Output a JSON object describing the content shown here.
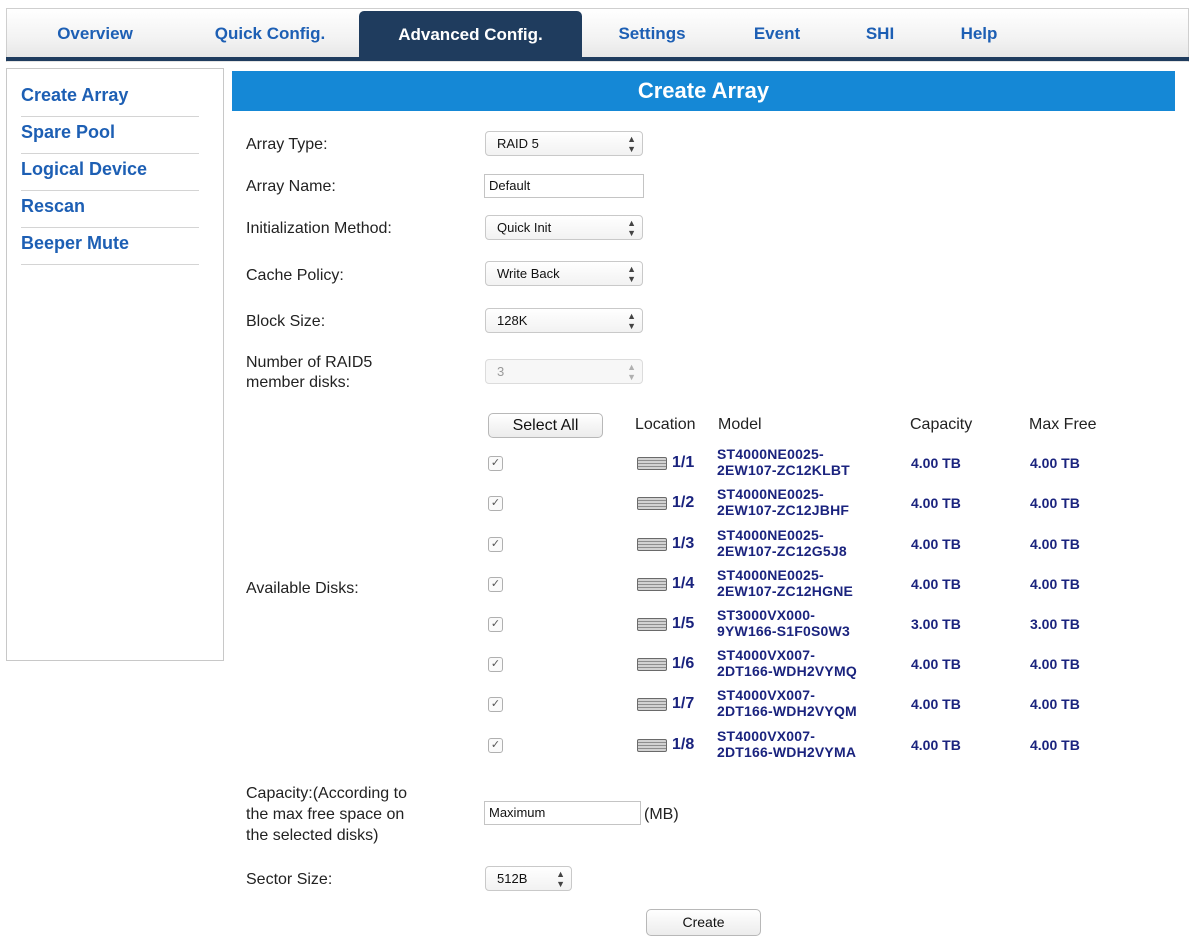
{
  "nav": {
    "tabs": [
      {
        "label": "Overview"
      },
      {
        "label": "Quick Config."
      },
      {
        "label": "Advanced Config.",
        "active": true
      },
      {
        "label": "Settings"
      },
      {
        "label": "Event"
      },
      {
        "label": "SHI"
      },
      {
        "label": "Help"
      }
    ]
  },
  "sidebar": {
    "items": [
      {
        "label": "Create Array"
      },
      {
        "label": "Spare Pool"
      },
      {
        "label": "Logical Device"
      },
      {
        "label": "Rescan"
      },
      {
        "label": "Beeper Mute"
      }
    ]
  },
  "page": {
    "title": "Create Array"
  },
  "form": {
    "array_type": {
      "label": "Array Type:",
      "value": "RAID 5"
    },
    "array_name": {
      "label": "Array Name:",
      "value": "Default"
    },
    "init_method": {
      "label": "Initialization Method:",
      "value": "Quick Init"
    },
    "cache_policy": {
      "label": "Cache Policy:",
      "value": "Write Back"
    },
    "block_size": {
      "label": "Block Size:",
      "value": "128K"
    },
    "member_disks": {
      "label_line1": "Number of RAID5",
      "label_line2": "member disks:",
      "value": "3",
      "disabled": true
    },
    "available_disks_label": "Available Disks:",
    "capacity": {
      "label_line1": "Capacity:(According to",
      "label_line2": "the max free space on",
      "label_line3": "the selected disks)",
      "value": "Maximum",
      "unit": "(MB)"
    },
    "sector_size": {
      "label": "Sector Size:",
      "value": "512B"
    },
    "create_label": "Create"
  },
  "disks": {
    "select_all_label": "Select All",
    "headers": {
      "location": "Location",
      "model": "Model",
      "capacity": "Capacity",
      "max_free": "Max Free"
    },
    "rows": [
      {
        "checked": true,
        "location": "1/1",
        "model_line1": "ST4000NE0025-",
        "model_line2": "2EW107-ZC12KLBT",
        "capacity": "4.00 TB",
        "max_free": "4.00 TB"
      },
      {
        "checked": true,
        "location": "1/2",
        "model_line1": "ST4000NE0025-",
        "model_line2": "2EW107-ZC12JBHF",
        "capacity": "4.00 TB",
        "max_free": "4.00 TB"
      },
      {
        "checked": true,
        "location": "1/3",
        "model_line1": "ST4000NE0025-",
        "model_line2": "2EW107-ZC12G5J8",
        "capacity": "4.00 TB",
        "max_free": "4.00 TB"
      },
      {
        "checked": true,
        "location": "1/4",
        "model_line1": "ST4000NE0025-",
        "model_line2": "2EW107-ZC12HGNE",
        "capacity": "4.00 TB",
        "max_free": "4.00 TB"
      },
      {
        "checked": true,
        "location": "1/5",
        "model_line1": "ST3000VX000-",
        "model_line2": "9YW166-S1F0S0W3",
        "capacity": "3.00 TB",
        "max_free": "3.00 TB"
      },
      {
        "checked": true,
        "location": "1/6",
        "model_line1": "ST4000VX007-",
        "model_line2": "2DT166-WDH2VYMQ",
        "capacity": "4.00 TB",
        "max_free": "4.00 TB"
      },
      {
        "checked": true,
        "location": "1/7",
        "model_line1": "ST4000VX007-",
        "model_line2": "2DT166-WDH2VYQM",
        "capacity": "4.00 TB",
        "max_free": "4.00 TB"
      },
      {
        "checked": true,
        "location": "1/8",
        "model_line1": "ST4000VX007-",
        "model_line2": "2DT166-WDH2VYMA",
        "capacity": "4.00 TB",
        "max_free": "4.00 TB"
      }
    ]
  },
  "icons": {
    "disk": "hard-disk-icon",
    "select_arrow": "up-down-arrows-icon",
    "checkbox": "checkmark-icon"
  },
  "colors": {
    "accent": "#1588d6",
    "nav_active": "#1f3c5e",
    "link": "#1d5fb4",
    "data_text": "#1a237e"
  }
}
